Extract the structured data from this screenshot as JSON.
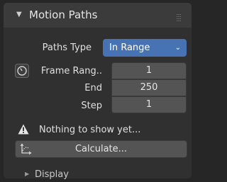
{
  "panel": {
    "title": "Motion Paths",
    "paths_type_label": "Paths Type",
    "paths_type_value": "In Range",
    "frame_range_label": "Frame Rang..",
    "frame_range_value": "1",
    "end_label": "End",
    "end_value": "250",
    "step_label": "Step",
    "step_value": "1",
    "status_message": "Nothing to show yet...",
    "calculate_label": "Calculate...",
    "subpanel_label": "Display"
  },
  "colors": {
    "accent": "#4772b3",
    "panel_bg": "#303030",
    "field_bg": "#545454"
  },
  "icons": {
    "collapse": "triangle-down-icon",
    "drag": "grip-icon",
    "frame_range": "clock-icon",
    "warning": "warning-icon",
    "calculate": "motion-path-icon",
    "expand": "triangle-right-icon"
  }
}
